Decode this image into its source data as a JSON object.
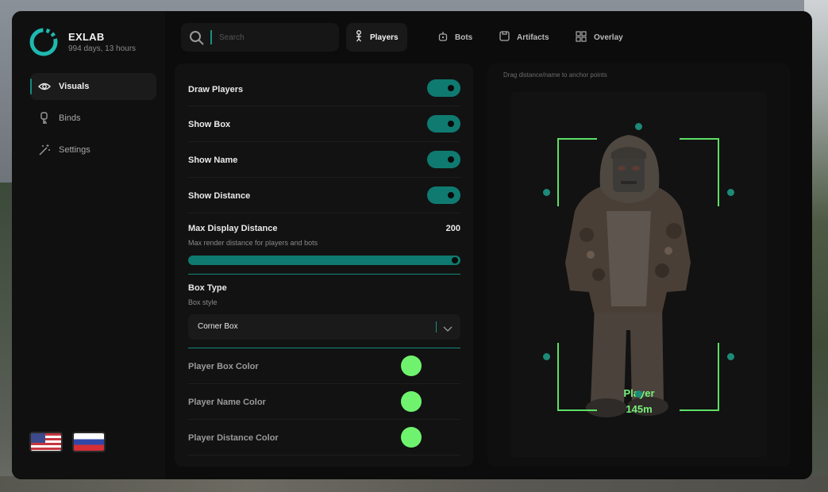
{
  "app": {
    "name": "EXLAB",
    "subtitle": "994 days, 13 hours",
    "accent_color": "#0f7a70"
  },
  "sidebar": {
    "items": [
      {
        "label": "Visuals",
        "icon": "eye-icon",
        "active": true
      },
      {
        "label": "Binds",
        "icon": "key-icon",
        "active": false
      },
      {
        "label": "Settings",
        "icon": "magic-wand-icon",
        "active": false
      }
    ],
    "languages": [
      "us-flag",
      "ru-flag"
    ]
  },
  "search": {
    "placeholder": "Search",
    "value": ""
  },
  "tabs": [
    {
      "label": "Players",
      "icon": "person-icon",
      "active": true
    },
    {
      "label": "Bots",
      "icon": "bot-icon",
      "active": false
    },
    {
      "label": "Artifacts",
      "icon": "artifact-icon",
      "active": false
    },
    {
      "label": "Overlay",
      "icon": "grid-icon",
      "active": false
    }
  ],
  "settings": {
    "draw_players": {
      "label": "Draw Players",
      "on": true
    },
    "show_box": {
      "label": "Show Box",
      "on": true
    },
    "show_name": {
      "label": "Show Name",
      "on": true
    },
    "show_distance": {
      "label": "Show Distance",
      "on": true
    },
    "max_distance": {
      "label": "Max Display Distance",
      "description": "Max render distance for players and bots",
      "value": "200",
      "fraction": 1.0
    },
    "box_type": {
      "label": "Box Type",
      "description": "Box style",
      "selected": "Corner Box"
    },
    "box_color": {
      "label": "Player Box Color",
      "color": "#6ff36e"
    },
    "name_color": {
      "label": "Player Name Color",
      "color": "#6ff36e"
    },
    "distance_color": {
      "label": "Player Distance Color",
      "color": "#6ff36e"
    }
  },
  "preview": {
    "hint": "Drag distance/name to anchor points",
    "player_name": "Player",
    "player_distance": "145m",
    "box_color": "#5ddf66"
  }
}
